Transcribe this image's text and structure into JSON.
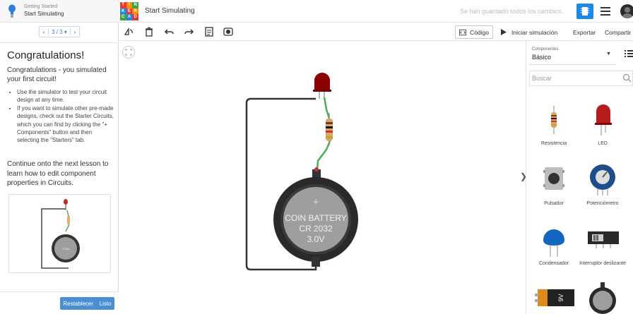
{
  "lesson": {
    "subtitle": "Getting Started",
    "title": "Start Simulating",
    "pager": {
      "prev": "‹",
      "current": "3 / 3 ▾",
      "next": "›"
    },
    "heading": "Congratulations!",
    "intro": "Congratulations - you simulated your first circuit!",
    "bullets": [
      "Use the simulator to test your circuit design at any time.",
      "If you want to simulate other pre-made designs, check out the Starter Circuits, which you can find by clicking the \"+ Components\" button and then selecting the \"Starters\" tab."
    ],
    "outro": "Continue onto the next lesson to learn how to edit component properties in Circuits.",
    "reset_label": "Restablecer",
    "done_label": "Listo"
  },
  "header": {
    "logo_letters": [
      "TIN",
      "KER",
      "CAD"
    ],
    "project_title": "Start Simulating",
    "save_status": "Se han guardado todos los cambios."
  },
  "toolbar": {
    "code_label": "Código",
    "simulate_label": "Iniciar simulación",
    "export_label": "Exportar",
    "share_label": "Compartir"
  },
  "battery": {
    "line1": "COIN BATTERY",
    "line2": "CR 2032",
    "line3": "3.0V",
    "plus": "+"
  },
  "components": {
    "select_label": "Componentes",
    "select_value": "Básico",
    "search_placeholder": "Buscar",
    "items": [
      {
        "label": "Resistencia",
        "icon": "resistor-icon"
      },
      {
        "label": "LED",
        "icon": "led-icon"
      },
      {
        "label": "Pulsador",
        "icon": "pushbutton-icon"
      },
      {
        "label": "Potenciómetro",
        "icon": "potentiometer-icon"
      },
      {
        "label": "Condensador",
        "icon": "capacitor-icon"
      },
      {
        "label": "Interruptor deslizante",
        "icon": "slide-switch-icon"
      },
      {
        "label": "",
        "icon": "9v-battery-icon",
        "marking": "9V"
      },
      {
        "label": "",
        "icon": "coin-battery-icon"
      }
    ]
  },
  "colors": {
    "accent": "#1e88e5",
    "reset_button": "#4a8fd4",
    "wire_green": "#4caf50",
    "wire_dark": "#333333",
    "led_red": "#b71c1c",
    "battery_body": "#9e9e9e"
  }
}
